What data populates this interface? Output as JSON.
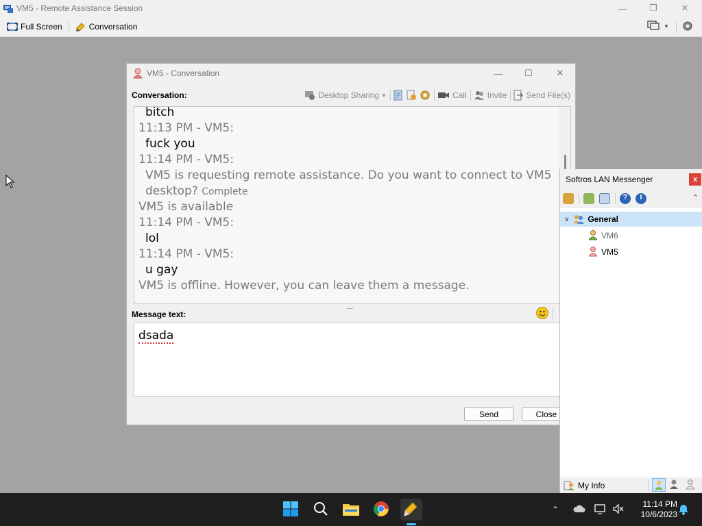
{
  "outer": {
    "title": "VM5 - Remote Assistance Session",
    "fullscreen_label": "Full Screen",
    "conversation_label": "Conversation"
  },
  "conversation": {
    "title": "VM5 - Conversation",
    "label": "Conversation:",
    "tools": {
      "desktop_sharing": "Desktop Sharing",
      "call": "Call",
      "invite": "Invite",
      "send_files": "Send File(s)"
    },
    "messages": [
      {
        "text": "bitch",
        "style": "black indent"
      },
      {
        "text": "11:13 PM - VM5:",
        "style": "gray"
      },
      {
        "text": "fuck you",
        "style": "black indent"
      },
      {
        "text": "11:14 PM - VM5:",
        "style": "gray"
      },
      {
        "text": "VM5 is requesting remote assistance. Do you want to connect to VM5",
        "style": "gray indent"
      },
      {
        "text": "desktop?",
        "style": "gray indent",
        "suffix": "Complete"
      },
      {
        "text": "VM5 is available",
        "style": "gray"
      },
      {
        "text": "11:14 PM - VM5:",
        "style": "gray"
      },
      {
        "text": "lol",
        "style": "black indent"
      },
      {
        "text": "11:14 PM - VM5:",
        "style": "gray"
      },
      {
        "text": "u gay",
        "style": "black indent"
      },
      {
        "text": "VM5 is offline. However, you can leave them a message.",
        "style": "gray"
      }
    ],
    "message_label": "Message text:",
    "input_value": "dsada",
    "send_label": "Send",
    "close_label": "Close"
  },
  "messenger": {
    "title": "Softros LAN Messenger",
    "close_symbol": "x",
    "group": "General",
    "contacts": [
      {
        "name": "VM6",
        "status": "online",
        "color": "#e8a33a"
      },
      {
        "name": "VM5",
        "status": "offline",
        "color": "#e47c7c"
      }
    ],
    "my_info": "My Info"
  },
  "taskbar": {
    "time": "11:14 PM",
    "date": "10/6/2023"
  },
  "colors": {
    "selection": "#cce4f7",
    "taskbar": "#1f1f1f",
    "accent": "#0078d4"
  }
}
